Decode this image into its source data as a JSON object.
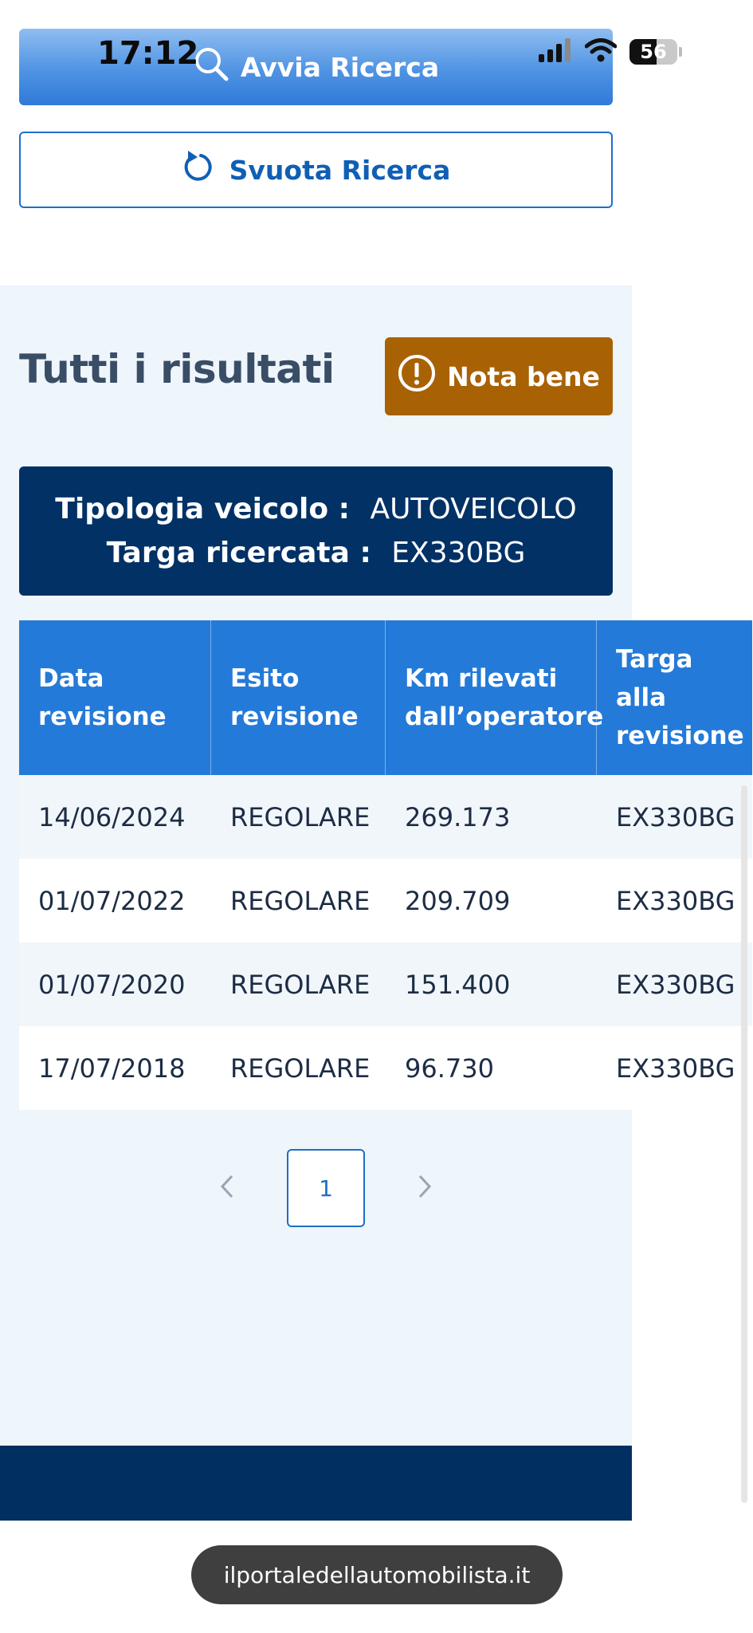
{
  "status_bar": {
    "time": "17:12",
    "battery_level": "56",
    "battery_fraction": 0.56
  },
  "search": {
    "start_label": "Avvia Ricerca",
    "clear_label": "Svuota Ricerca"
  },
  "results": {
    "title": "Tutti i risultati",
    "note_label": "Nota bene",
    "vehicle_type_label": "Tipologia veicolo :",
    "vehicle_type_value": "AUTOVEICOLO",
    "plate_label": "Targa ricercata :",
    "plate_value": "EX330BG"
  },
  "table": {
    "headers": [
      "Data revisione",
      "Esito revisione",
      "Km rilevati dall’operatore",
      "Targa alla revisione"
    ],
    "rows": [
      [
        "14/06/2024",
        "REGOLARE",
        "269.173",
        "EX330BG"
      ],
      [
        "01/07/2022",
        "REGOLARE",
        "209.709",
        "EX330BG"
      ],
      [
        "01/07/2020",
        "REGOLARE",
        "151.400",
        "EX330BG"
      ],
      [
        "17/07/2018",
        "REGOLARE",
        "96.730",
        "EX330BG"
      ]
    ]
  },
  "pagination": {
    "current_page": "1"
  },
  "browser": {
    "url": "ilportaledellautomobilista.it"
  },
  "colors": {
    "primary": "#247ad8",
    "dark_navy": "#023165",
    "note_orange": "#a86204",
    "section_bg": "#eef5fb"
  },
  "icons": {
    "search": "search-icon",
    "clear": "refresh-icon",
    "note": "exclamation-circle-icon",
    "prev": "chevron-left-icon",
    "next": "chevron-right-icon"
  }
}
